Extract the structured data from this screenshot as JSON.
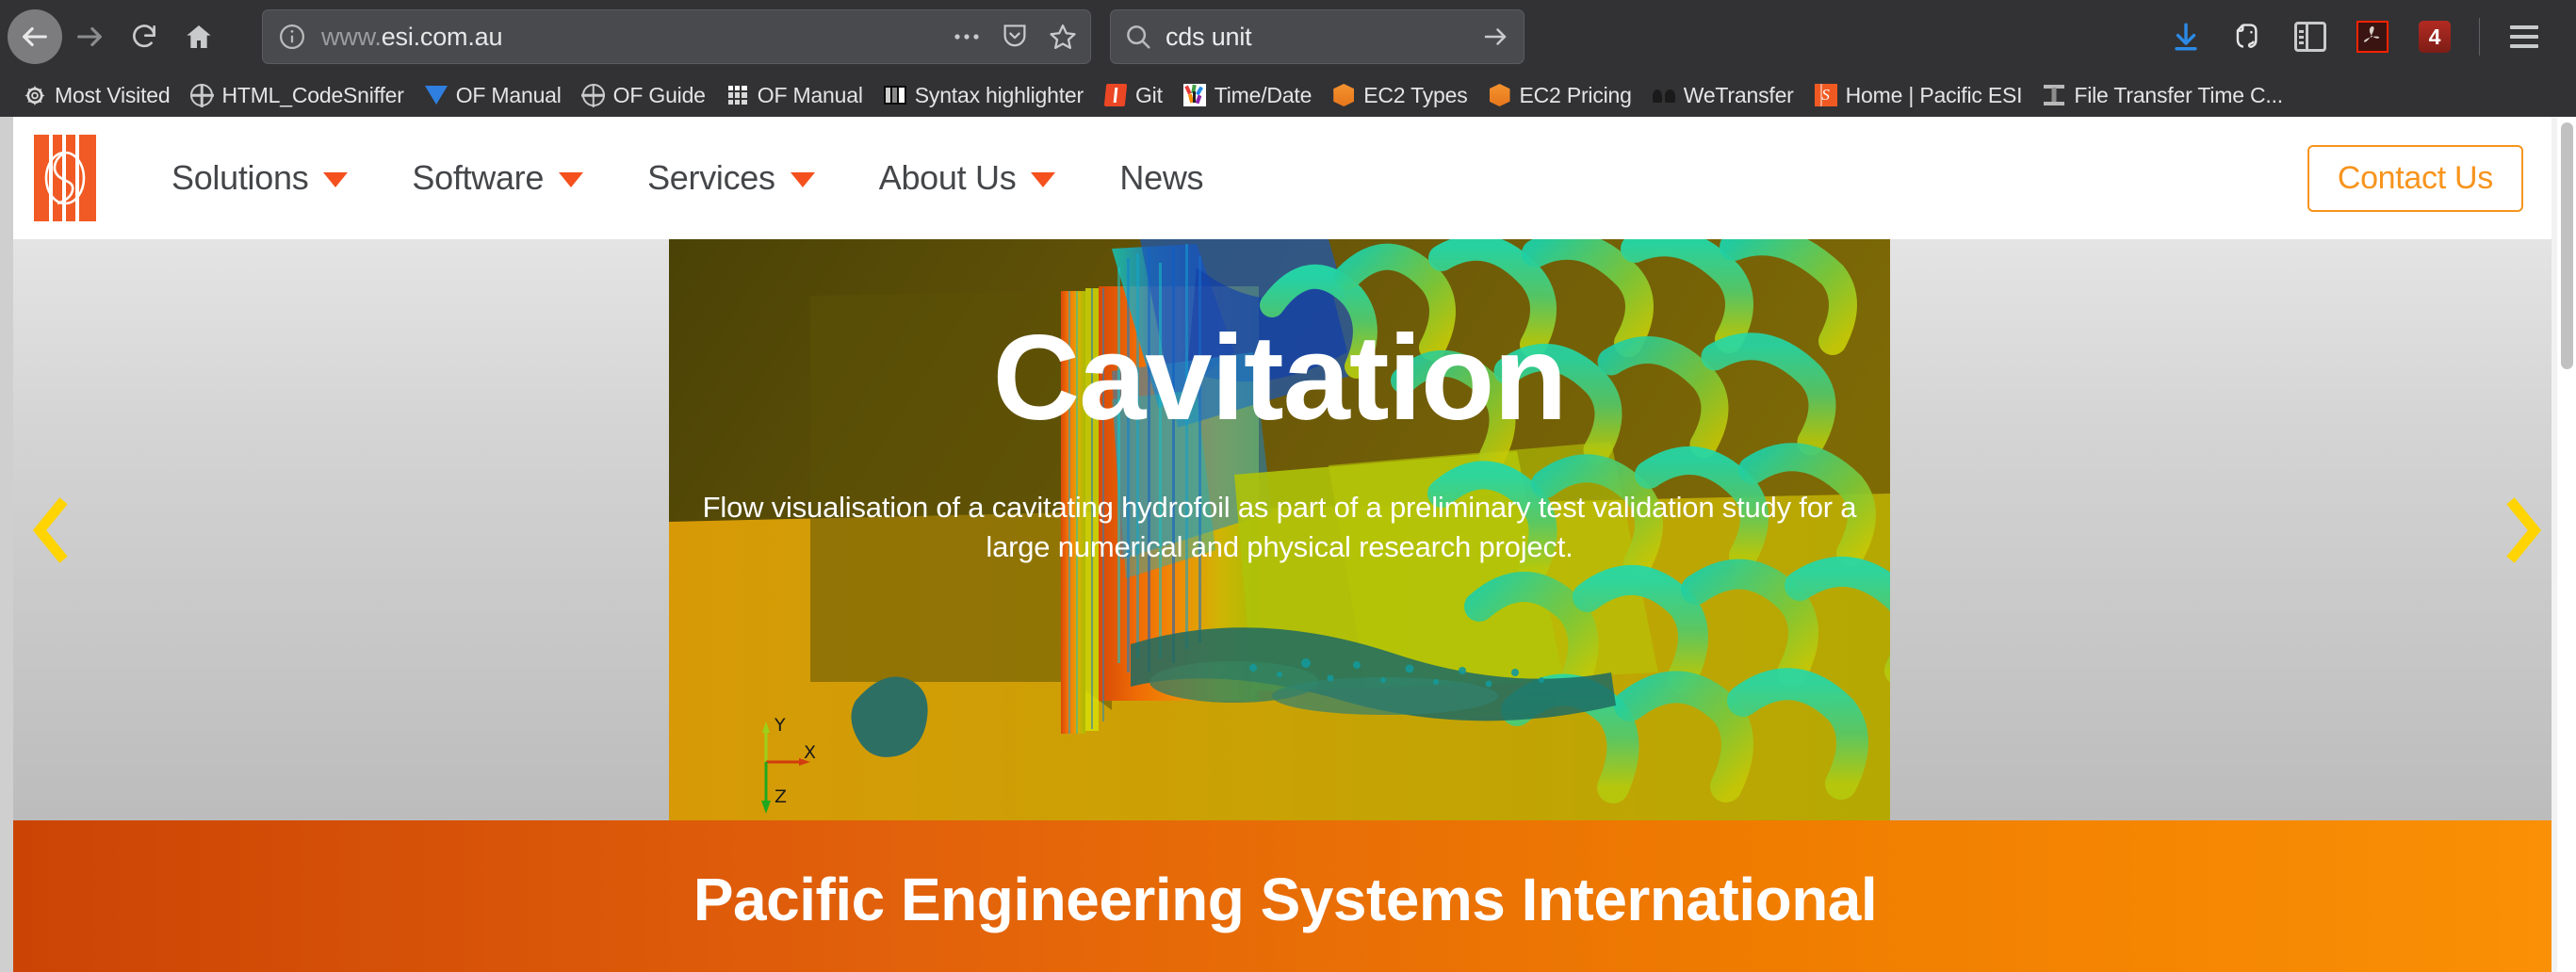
{
  "browser": {
    "nav": {
      "back": "back-arrow",
      "forward": "forward-arrow",
      "reload": "reload",
      "home": "home"
    },
    "url_bar": {
      "identity_icon": "info-icon",
      "url_prefix": "www.",
      "url_domain": "esi.com.au",
      "full_url": "www.esi.com.au",
      "page_actions_icon": "ellipsis-icon",
      "pocket_icon": "pocket-icon",
      "bookmark_icon": "star-icon"
    },
    "search_bar": {
      "icon": "search-icon",
      "value": "cds unit",
      "go_icon": "arrow-right-icon"
    },
    "toolbar_right": [
      {
        "name": "downloads-button",
        "icon": "download-arrow-icon",
        "label": ""
      },
      {
        "name": "evernote-button",
        "icon": "evernote-elephant-icon",
        "label": ""
      },
      {
        "name": "sidebar-toggle-button",
        "icon": "sidebar-panel-icon",
        "label": ""
      },
      {
        "name": "adobe-pdf-button",
        "icon": "adobe-acrobat-icon",
        "label": ""
      },
      {
        "name": "notification-badge",
        "icon": "badge-icon",
        "label": "4"
      },
      {
        "name": "app-menu-button",
        "icon": "hamburger-menu-icon",
        "label": ""
      }
    ],
    "bookmarks": [
      {
        "label": "Most Visited",
        "icon": "gear-icon"
      },
      {
        "label": "HTML_CodeSniffer",
        "icon": "globe-icon"
      },
      {
        "label": "OF Manual",
        "icon": "blue-triangle-icon"
      },
      {
        "label": "OF Guide",
        "icon": "globe-icon"
      },
      {
        "label": "OF Manual",
        "icon": "dot-grid-icon"
      },
      {
        "label": "Syntax highlighter",
        "icon": "syntax-bars-icon"
      },
      {
        "label": "Git",
        "icon": "git-diamond-icon"
      },
      {
        "label": "Time/Date",
        "icon": "time-date-icon"
      },
      {
        "label": "EC2 Types",
        "icon": "aws-ec2-cube-icon"
      },
      {
        "label": "EC2 Pricing",
        "icon": "aws-ec2-cube-icon"
      },
      {
        "label": "WeTransfer",
        "icon": "wetransfer-icon"
      },
      {
        "label": "Home | Pacific ESI",
        "icon": "esi-logo-icon"
      },
      {
        "label": "File Transfer Time C...",
        "icon": "beam-icon"
      }
    ]
  },
  "site": {
    "logo": {
      "name": "esi-logo",
      "accent_color": "#f15a24"
    },
    "nav_items": [
      {
        "label": "Solutions",
        "has_dropdown": true
      },
      {
        "label": "Software",
        "has_dropdown": true
      },
      {
        "label": "Services",
        "has_dropdown": true
      },
      {
        "label": "About Us",
        "has_dropdown": true
      },
      {
        "label": "News",
        "has_dropdown": false
      }
    ],
    "contact_button": {
      "label": "Contact Us",
      "border_color": "#f7941e",
      "text_color": "#f7941e"
    },
    "hero": {
      "title": "Cavitation",
      "subtitle": "Flow visualisation of a cavitating hydrofoil as part of a preliminary test validation study for a large numerical and physical research project.",
      "prev_icon": "chevron-left-icon",
      "next_icon": "chevron-right-icon",
      "arrow_color": "#ffd400",
      "axis_labels": {
        "x": "X",
        "y": "Y",
        "z": "Z"
      }
    },
    "banner": {
      "title": "Pacific Engineering Systems International",
      "gradient_from": "#cc4405",
      "gradient_to": "#fa9005"
    }
  }
}
